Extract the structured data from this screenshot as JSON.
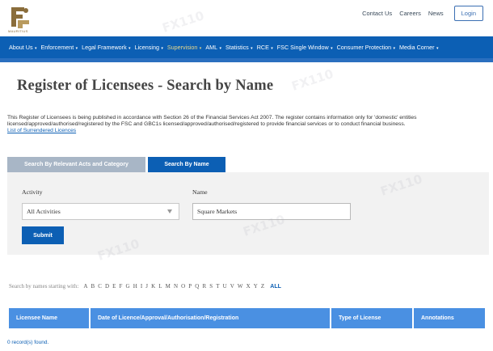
{
  "header": {
    "logo_text": "MAURITIUS",
    "links": [
      "Contact Us",
      "Careers",
      "News"
    ],
    "login_label": "Login"
  },
  "nav": {
    "items": [
      {
        "label": "About Us",
        "highlight": false
      },
      {
        "label": "Enforcement",
        "highlight": false
      },
      {
        "label": "Legal Framework",
        "highlight": false
      },
      {
        "label": "Licensing",
        "highlight": false
      },
      {
        "label": "Supervision",
        "highlight": true
      },
      {
        "label": "AML",
        "highlight": false
      },
      {
        "label": "Statistics",
        "highlight": false
      },
      {
        "label": "RCE",
        "highlight": false
      },
      {
        "label": "FSC Single Window",
        "highlight": false
      },
      {
        "label": "Consumer Protection",
        "highlight": false
      },
      {
        "label": "Media Corner",
        "highlight": false
      }
    ]
  },
  "page": {
    "title": "Register of Licensees - Search by Name",
    "intro": "This Register of Licensees is being published in accordance with Section 26 of the Financial Services Act 2007. The register contains information only for 'domestic' entities licensed/approved/authorised/registered by the FSC and GBC1s licensed/approved/authorised/registered to provide financial services or to conduct financial business.",
    "surrendered_link": "List of Surrendered Licences"
  },
  "tabs": [
    {
      "label": "Search By Relevant Acts and Category",
      "active": false
    },
    {
      "label": "Search By Name",
      "active": true
    }
  ],
  "form": {
    "activity_label": "Activity",
    "activity_value": "All Activities",
    "name_label": "Name",
    "name_value": "Square Markets",
    "submit_label": "Submit"
  },
  "alphabet": {
    "prefix": "Search by names starting with:",
    "letters": [
      "A",
      "B",
      "C",
      "D",
      "E",
      "F",
      "G",
      "H",
      "I",
      "J",
      "K",
      "L",
      "M",
      "N",
      "O",
      "P",
      "Q",
      "R",
      "S",
      "T",
      "U",
      "V",
      "W",
      "X",
      "Y",
      "Z"
    ],
    "all_label": "ALL"
  },
  "table": {
    "headers": [
      "Licensee Name",
      "Date of Licence/Approval/Authorisation/Registration",
      "Type of License",
      "Annotations"
    ],
    "records_text": "0 record(s) found."
  },
  "colors": {
    "nav_bg": "#0c5fb4",
    "tab_active": "#0c5fb4",
    "tab_inactive": "#a8b6c6",
    "table_header": "#4a90e2"
  }
}
